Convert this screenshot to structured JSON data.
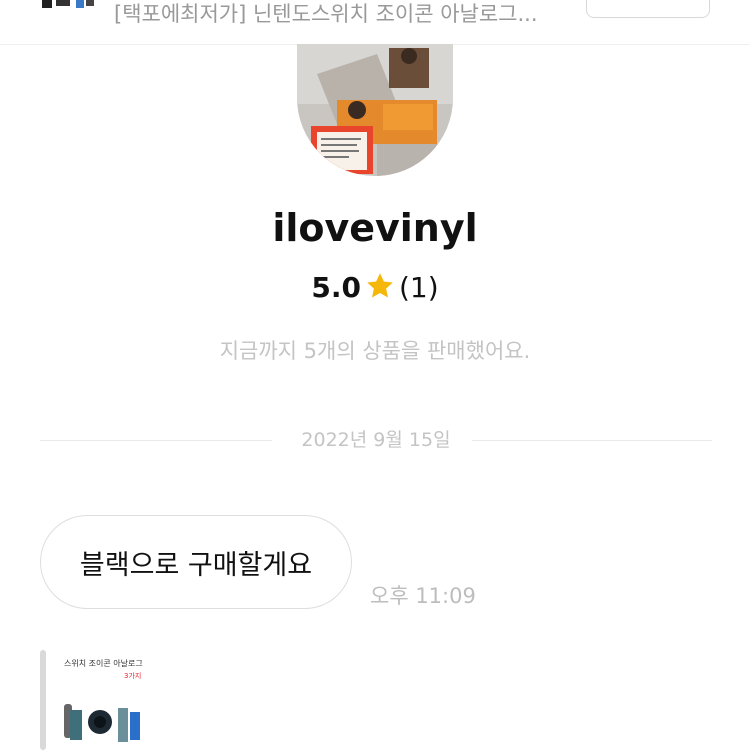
{
  "header": {
    "product_title": "[택포에최저가] 닌텐도스위치 조이콘 아날로그...",
    "action_button_label": ""
  },
  "seller": {
    "username": "ilovevinyl",
    "rating": "5.0",
    "review_count": "(1)",
    "sales_summary": "지금까지 5개의 상품을 판매했어요."
  },
  "chat": {
    "date_divider": "2022년 9월 15일",
    "messages": [
      {
        "text": "블랙으로 구매할게요",
        "time": "오후 11:09"
      }
    ],
    "product_card": {
      "title_snippet": "스위치 조이콘 아날로그",
      "sub_snippet": "3가지"
    }
  },
  "colors": {
    "star": "#f5b70a",
    "muted_text": "#c4c4c4",
    "border": "#dedede"
  },
  "icons": {
    "rating": "star-icon"
  }
}
